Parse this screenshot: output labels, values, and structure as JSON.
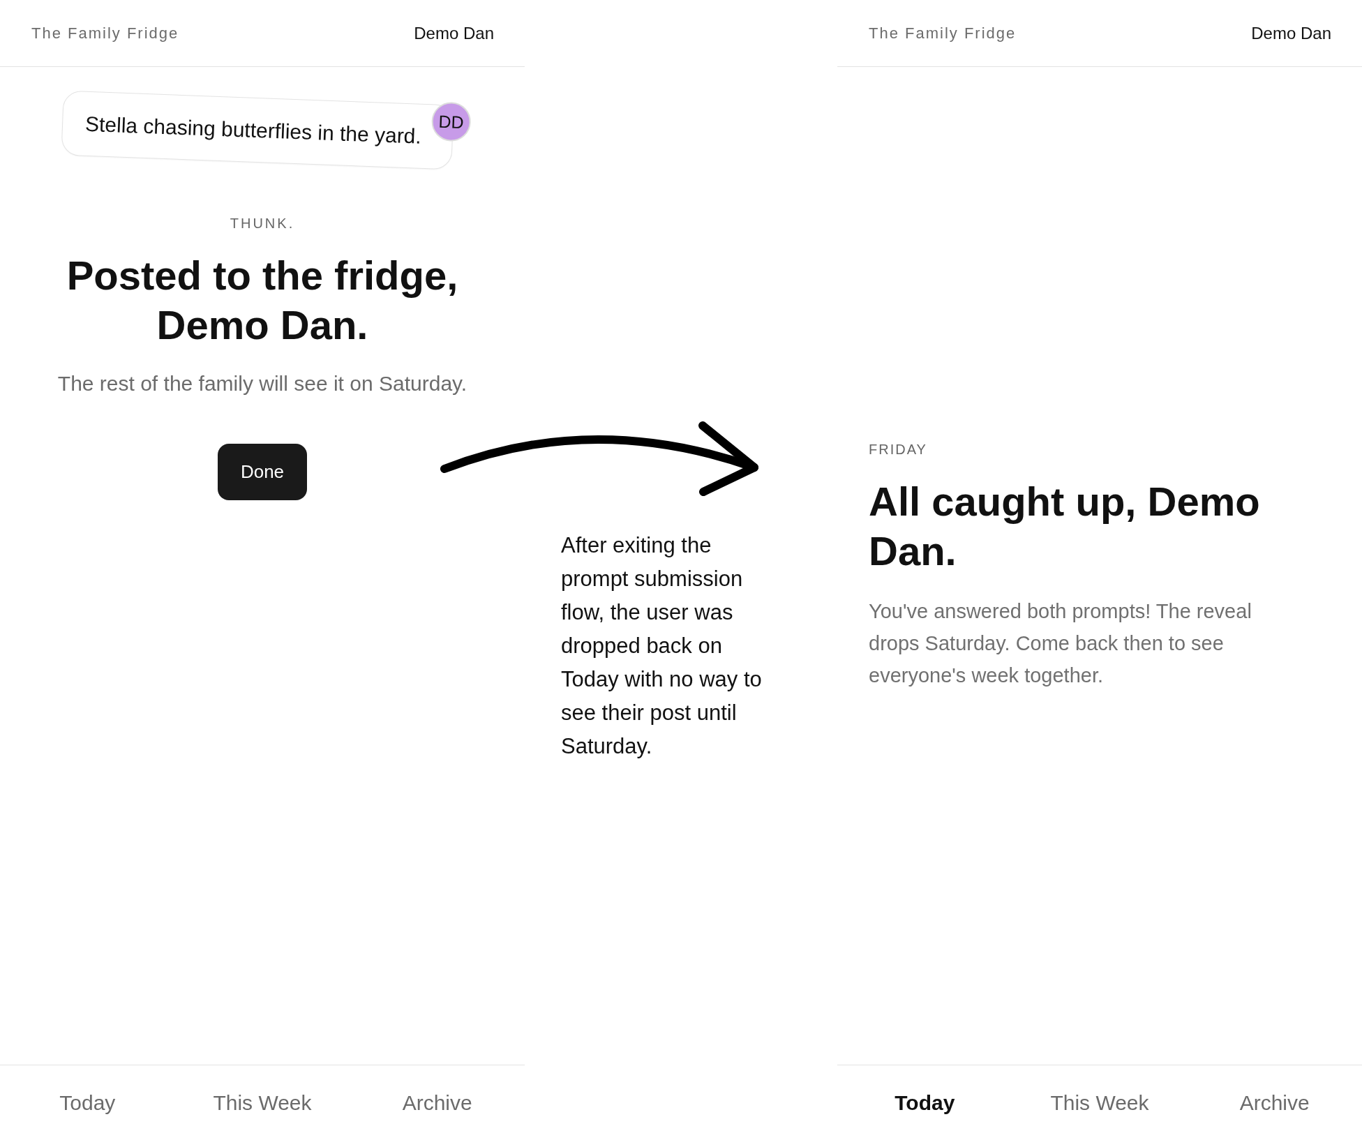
{
  "screens": [
    {
      "kind": "confirmation",
      "header": {
        "brand": "The Family Fridge",
        "user": "Demo Dan"
      },
      "note": {
        "text": "Stella chasing butterflies in the yard.",
        "initials": "DD"
      },
      "eyebrow": "THUNK.",
      "heading": "Posted to the fridge, Demo Dan.",
      "message": "The rest of the family will see it on Saturday.",
      "button": "Done",
      "tabs": [
        {
          "label": "Today",
          "selected": false
        },
        {
          "label": "This Week",
          "selected": false
        },
        {
          "label": "Archive",
          "selected": false
        }
      ]
    },
    {
      "kind": "empty_state",
      "header": {
        "brand": "The Family Fridge",
        "user": "Demo Dan"
      },
      "eyebrow": "FRIDAY",
      "heading": "All caught up, Demo Dan.",
      "message": "You've answered both prompts! The reveal drops Saturday. Come back then to see everyone's week together.",
      "tabs": [
        {
          "label": "Today",
          "selected": true
        },
        {
          "label": "This Week",
          "selected": false
        },
        {
          "label": "Archive",
          "selected": false
        }
      ]
    }
  ],
  "annotation": {
    "text": "After exiting the prompt submission flow, the user was dropped back on Today with no way to see their post until Saturday."
  }
}
